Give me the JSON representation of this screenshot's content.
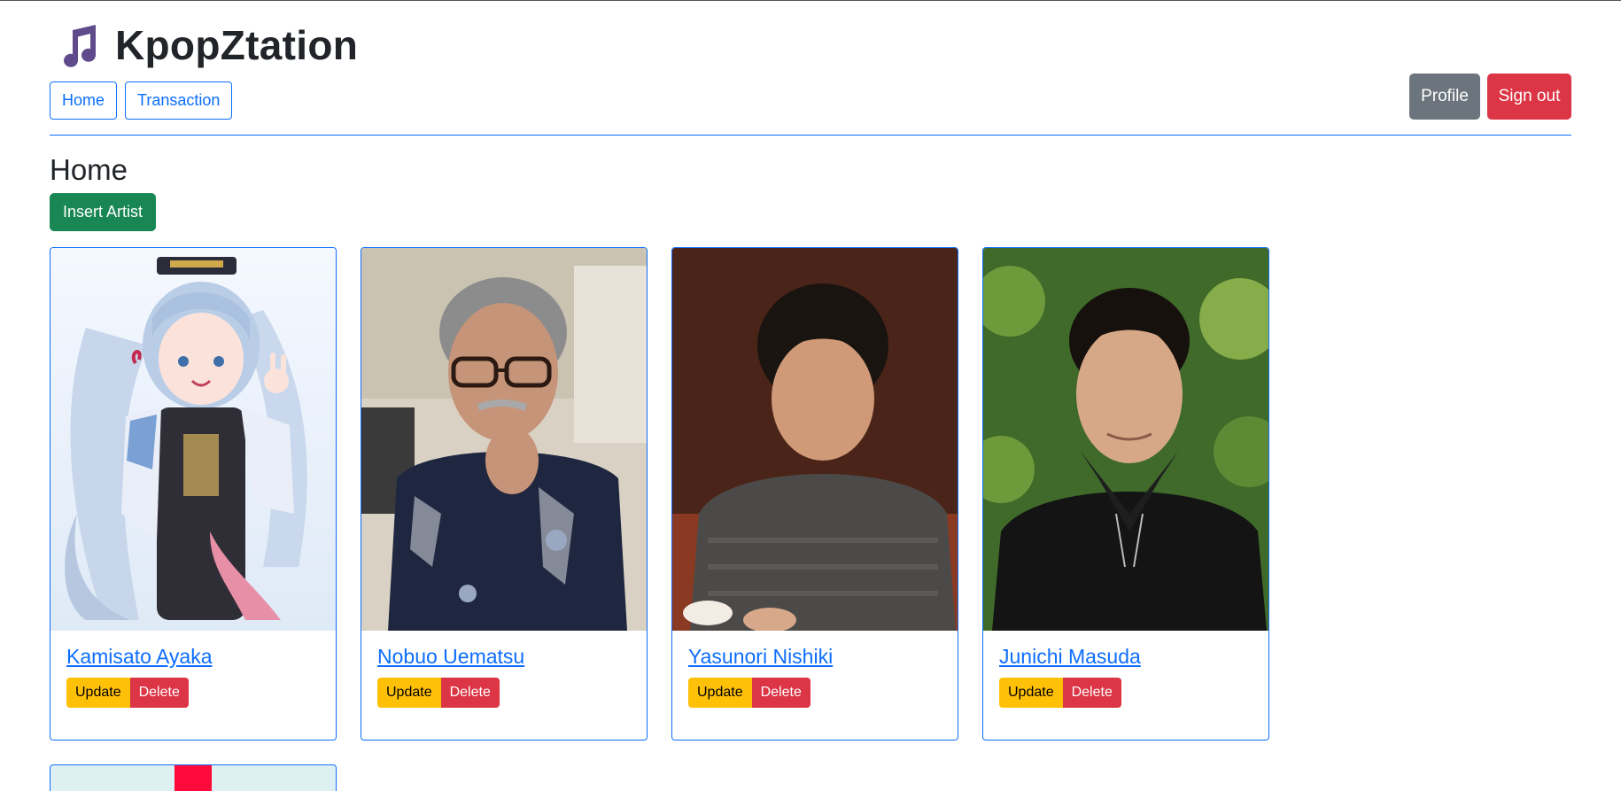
{
  "brand": {
    "title": "KpopZtation",
    "icon": "music-note-icon",
    "icon_color": "#5f4b8b"
  },
  "nav": {
    "home_label": "Home",
    "transaction_label": "Transaction"
  },
  "actions": {
    "profile_label": "Profile",
    "signout_label": "Sign out"
  },
  "page": {
    "title": "Home",
    "insert_label": "Insert Artist"
  },
  "artists": [
    {
      "name": "Kamisato Ayaka",
      "update_label": "Update",
      "delete_label": "Delete"
    },
    {
      "name": "Nobuo Uematsu",
      "update_label": "Update",
      "delete_label": "Delete"
    },
    {
      "name": "Yasunori Nishiki",
      "update_label": "Update",
      "delete_label": "Delete"
    },
    {
      "name": "Junichi Masuda",
      "update_label": "Update",
      "delete_label": "Delete"
    }
  ],
  "colors": {
    "primary": "#0d6efd",
    "secondary": "#6c757d",
    "danger": "#dc3545",
    "success": "#198754",
    "warning": "#ffc107"
  }
}
